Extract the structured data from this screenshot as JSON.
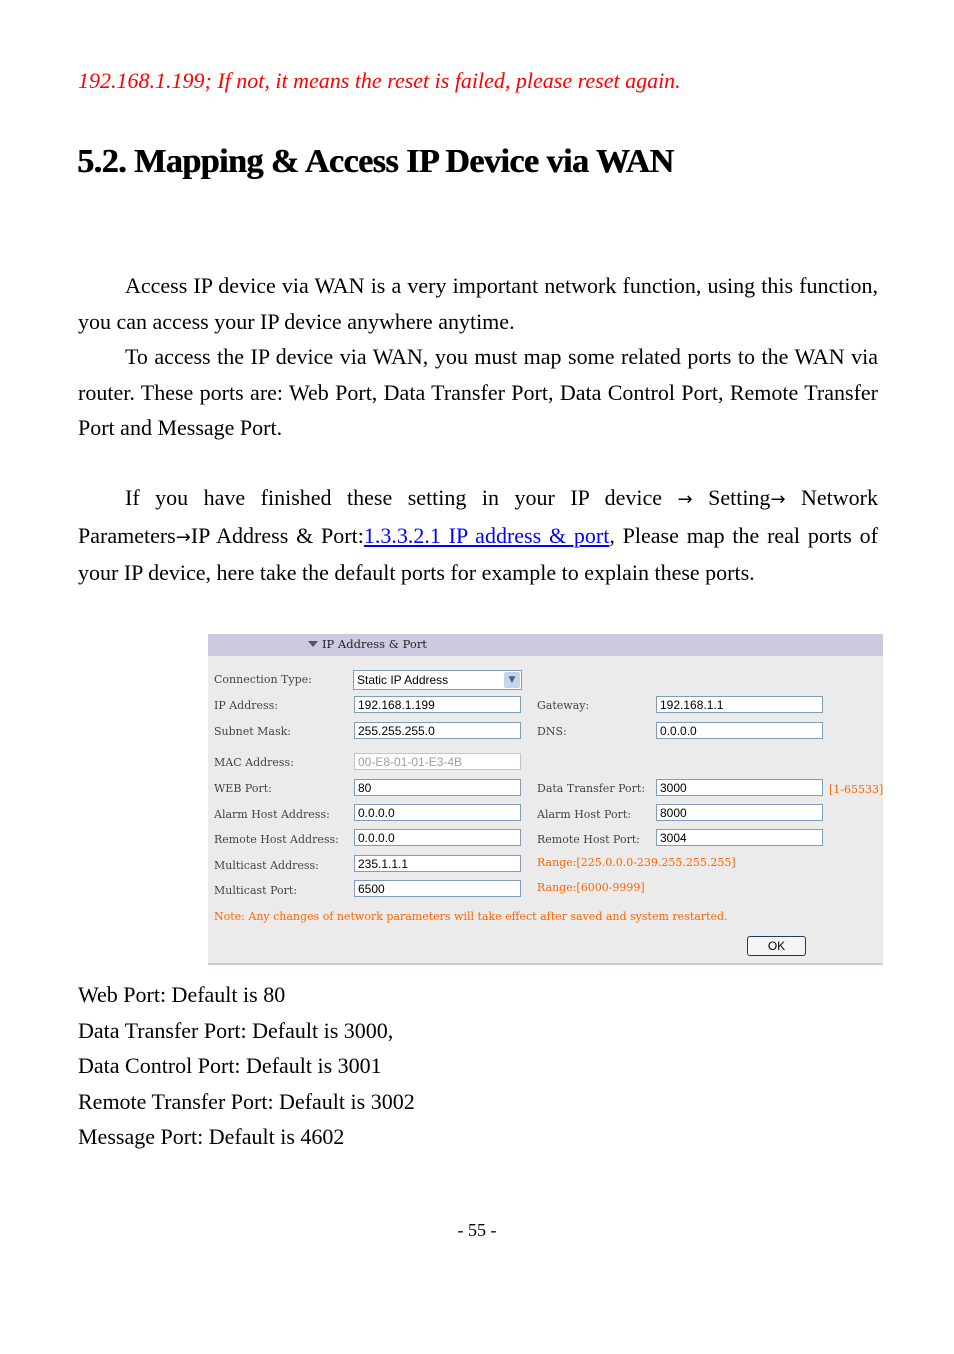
{
  "top_note": "192.168.1.199; If not, it means the reset is failed, please reset again.",
  "section_heading": "5.2. Mapping & Access IP Device via WAN",
  "paragraphs": {
    "p1": "Access IP device via WAN is a very important network function, using this function, you can access your IP device anywhere anytime.",
    "p2": "To access the IP device via WAN, you must map some related ports to the WAN via router. These ports are: Web Port, Data Transfer Port, Data Control Port, Remote Transfer Port and Message Port.",
    "p3_part1": "If you have finished these setting in your IP device",
    "p3_setting": "Setting",
    "p3_network": "Network Parameters",
    "p3_ipport": "IP Address & Port:",
    "p3_link": "1.3.3.2.1 IP address & port",
    "p3_part2": ", Please map the real ports of your IP device, here take the default ports for example to explain these ports.",
    "arrow": "→"
  },
  "panel": {
    "title": "IP Address & Port",
    "connection_type": {
      "label": "Connection Type:",
      "value": "Static IP Address"
    },
    "ip_address": {
      "label": "IP Address:",
      "value": "192.168.1.199"
    },
    "gateway": {
      "label": "Gateway:",
      "value": "192.168.1.1"
    },
    "subnet_mask": {
      "label": "Subnet Mask:",
      "value": "255.255.255.0"
    },
    "dns": {
      "label": "DNS:",
      "value": "0.0.0.0"
    },
    "mac_address": {
      "label": "MAC Address:",
      "value": "00-E8-01-01-E3-4B"
    },
    "web_port": {
      "label": "WEB Port:",
      "value": "80"
    },
    "data_transfer_port": {
      "label": "Data Transfer Port:",
      "value": "3000",
      "hint": "[1-65533]"
    },
    "alarm_host_address": {
      "label": "Alarm Host Address:",
      "value": "0.0.0.0"
    },
    "alarm_host_port": {
      "label": "Alarm Host Port:",
      "value": "8000"
    },
    "remote_host_address": {
      "label": "Remote Host Address:",
      "value": "0.0.0.0"
    },
    "remote_host_port": {
      "label": "Remote Host Port:",
      "value": "3004"
    },
    "multicast_address": {
      "label": "Multicast Address:",
      "value": "235.1.1.1",
      "hint": "Range:[225.0.0.0-239.255.255.255]"
    },
    "multicast_port": {
      "label": "Multicast Port:",
      "value": "6500",
      "hint": "Range:[6000-9999]"
    },
    "note": "Note: Any changes of network parameters will take effect after saved and system restarted.",
    "ok_label": "OK",
    "hint_color": "#ff6600"
  },
  "defaults": [
    "Web Port: Default is 80",
    "Data Transfer Port: Default is 3000,",
    "Data Control Port: Default is 3001",
    "Remote Transfer Port: Default is 3002",
    "Message Port: Default is 4602"
  ],
  "page_number": "- 55 -"
}
